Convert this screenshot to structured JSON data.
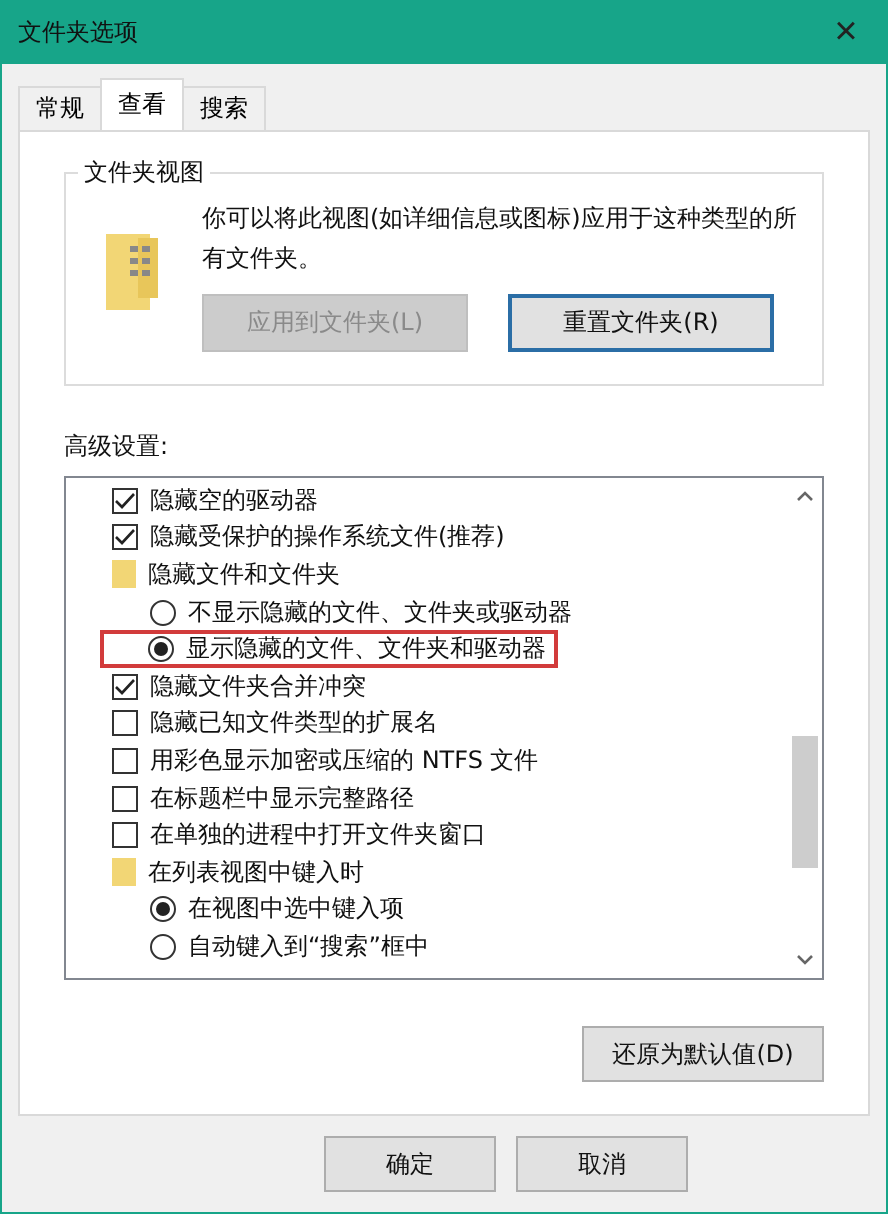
{
  "window": {
    "title": "文件夹选项",
    "close": "×"
  },
  "tabs": [
    {
      "label": "常规",
      "selected": false
    },
    {
      "label": "查看",
      "selected": true
    },
    {
      "label": "搜索",
      "selected": false
    }
  ],
  "folder_views": {
    "title": "文件夹视图",
    "description": "你可以将此视图(如详细信息或图标)应用于这种类型的所有文件夹。",
    "buttons": [
      {
        "label": "应用到文件夹(L)",
        "disabled": true
      },
      {
        "label": "重置文件夹(R)",
        "disabled": false
      }
    ]
  },
  "advanced": {
    "label": "高级设置:",
    "items": [
      {
        "kind": "checkbox",
        "label": "隐藏空的驱动器",
        "checked": true
      },
      {
        "kind": "checkbox",
        "label": "隐藏受保护的操作系统文件(推荐)",
        "checked": true
      },
      {
        "kind": "folder",
        "label": "隐藏文件和文件夹",
        "children": [
          {
            "kind": "radio",
            "label": "不显示隐藏的文件、文件夹或驱动器",
            "selected": false,
            "highlighted": false
          },
          {
            "kind": "radio",
            "label": "显示隐藏的文件、文件夹和驱动器",
            "selected": true,
            "highlighted": true
          }
        ]
      },
      {
        "kind": "checkbox",
        "label": "隐藏文件夹合并冲突",
        "checked": true
      },
      {
        "kind": "checkbox",
        "label": "隐藏已知文件类型的扩展名",
        "checked": false
      },
      {
        "kind": "checkbox",
        "label": "用彩色显示加密或压缩的 NTFS 文件",
        "checked": false
      },
      {
        "kind": "checkbox",
        "label": "在标题栏中显示完整路径",
        "checked": false
      },
      {
        "kind": "checkbox",
        "label": "在单独的进程中打开文件夹窗口",
        "checked": false
      },
      {
        "kind": "folder",
        "label": "在列表视图中键入时",
        "children": [
          {
            "kind": "radio",
            "label": "在视图中选中键入项",
            "selected": true,
            "highlighted": false
          },
          {
            "kind": "radio",
            "label": "自动键入到“搜索”框中",
            "selected": false,
            "highlighted": false
          }
        ]
      }
    ]
  },
  "restore_button": "还原为默认值(D)",
  "dialog_buttons": [
    "确定",
    "取消"
  ]
}
